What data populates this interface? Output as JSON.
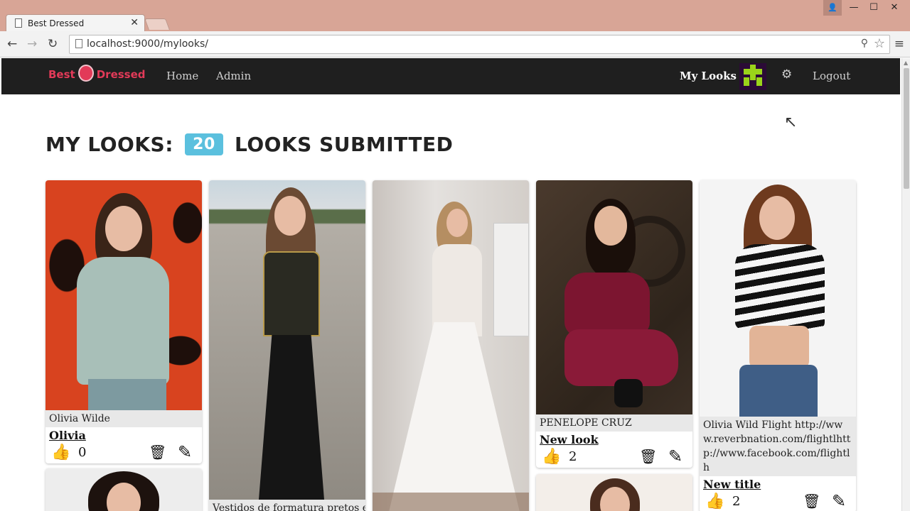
{
  "browser": {
    "tab_title": "Best Dressed",
    "url": "localhost:9000/mylooks/"
  },
  "navbar": {
    "brand_left": "Best",
    "brand_right": "Dressed",
    "links": [
      "Home",
      "Admin"
    ],
    "my_looks": "My Looks",
    "logout": "Logout"
  },
  "page": {
    "heading_prefix": "MY LOOKS:",
    "count": "20",
    "heading_suffix": "LOOKS SUBMITTED"
  },
  "looks": [
    {
      "caption": "Olivia Wilde",
      "title": "Olivia",
      "likes": "0"
    },
    {
      "caption": "Vestidos de formatura pretos e"
    },
    {},
    {
      "caption": "PENELOPE CRUZ",
      "title": "New look",
      "likes": "2"
    },
    {
      "caption": "Olivia Wild Flight http://www.reverbnation.com/flightlhttp://www.facebook.com/flightlh",
      "title": "New title",
      "likes": "2"
    }
  ],
  "colors": {
    "navbar_bg": "#1f1f1f",
    "brand": "#e23a58",
    "badge": "#5bc0de",
    "browser_frame": "#d8a596"
  }
}
